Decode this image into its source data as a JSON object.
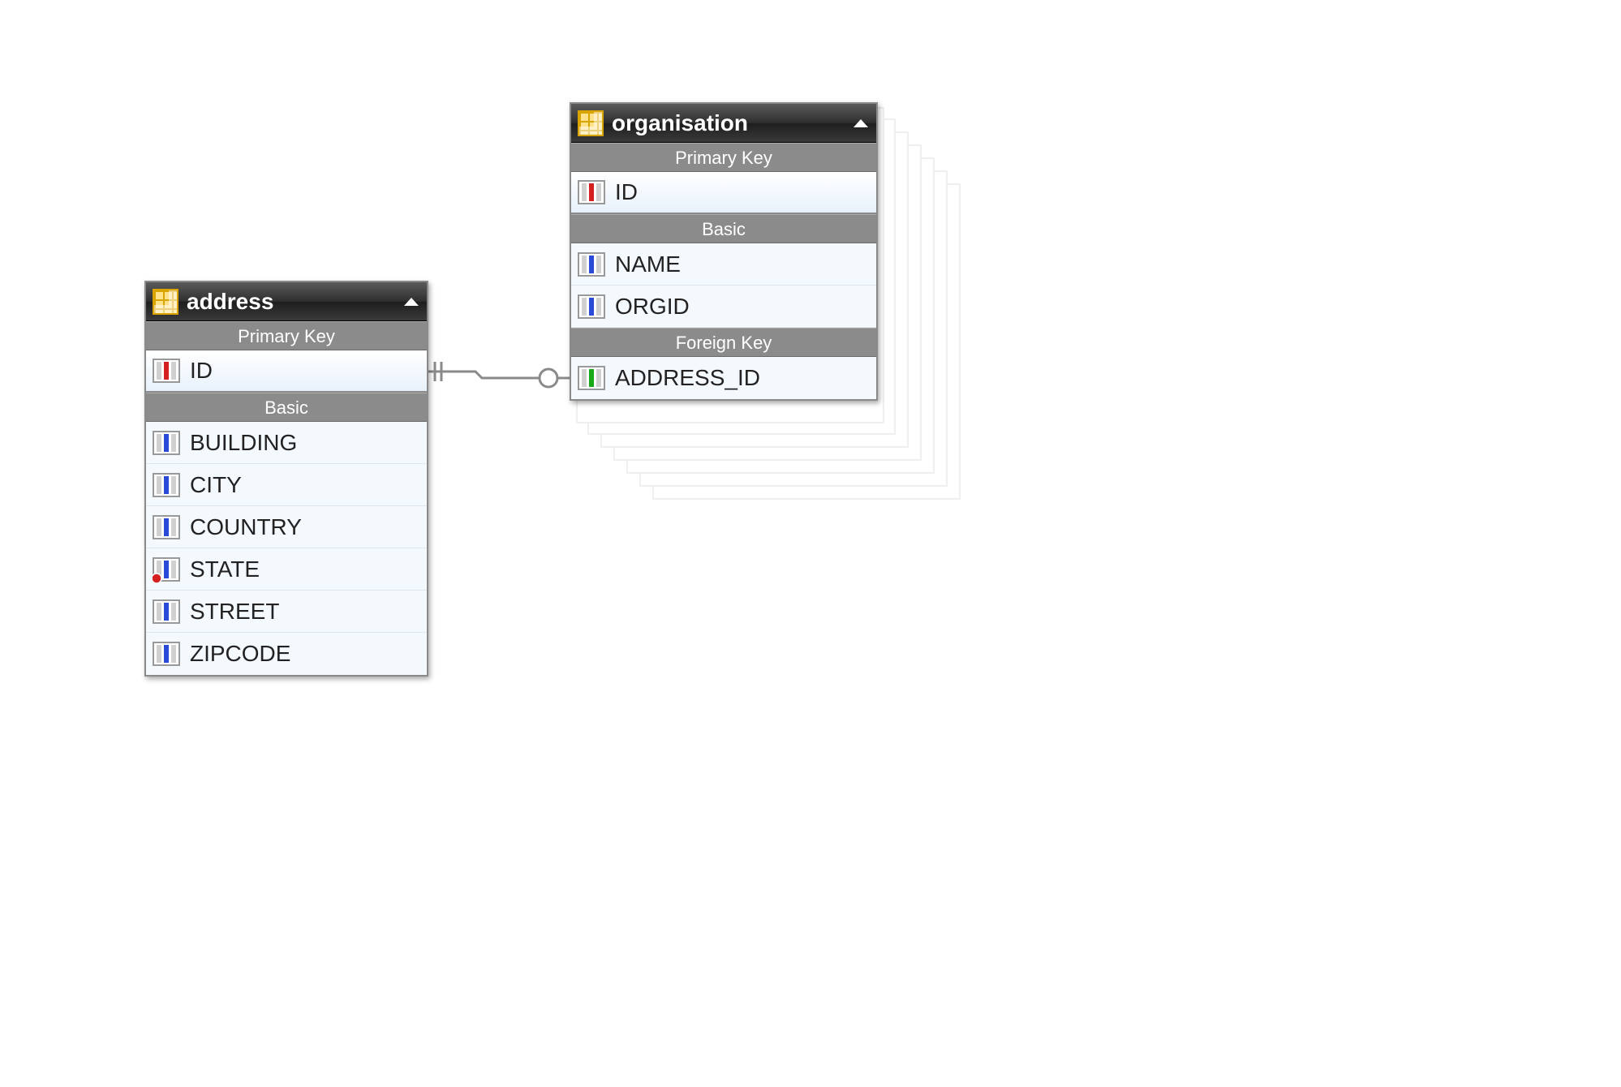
{
  "entities": {
    "address": {
      "title": "address",
      "sections": {
        "pk_label": "Primary Key",
        "basic_label": "Basic"
      },
      "pk": {
        "name": "ID"
      },
      "basic": [
        {
          "name": "BUILDING"
        },
        {
          "name": "CITY"
        },
        {
          "name": "COUNTRY"
        },
        {
          "name": "STATE"
        },
        {
          "name": "STREET"
        },
        {
          "name": "ZIPCODE"
        }
      ]
    },
    "organisation": {
      "title": "organisation",
      "sections": {
        "pk_label": "Primary Key",
        "basic_label": "Basic",
        "fk_label": "Foreign Key"
      },
      "pk": {
        "name": "ID"
      },
      "basic": [
        {
          "name": "NAME"
        },
        {
          "name": "ORGID"
        }
      ],
      "fk": [
        {
          "name": "ADDRESS_ID"
        }
      ]
    }
  }
}
